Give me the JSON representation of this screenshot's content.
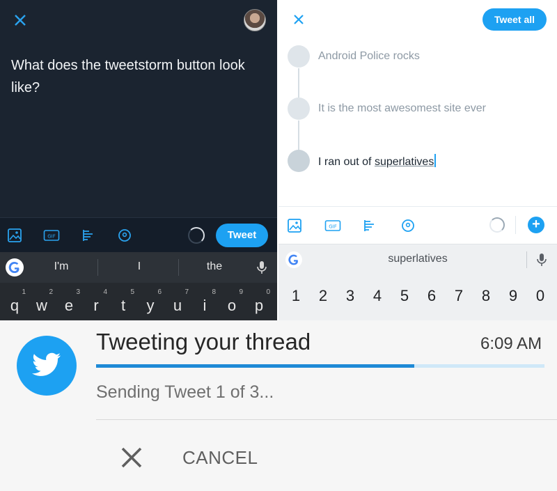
{
  "dark_composer": {
    "text": "What does the tweetstorm button look like?",
    "tweet_button": "Tweet",
    "toolbar_icons": [
      "image-icon",
      "gif-icon",
      "thread-icon",
      "location-icon"
    ],
    "suggestions": [
      "I'm",
      "I",
      "the"
    ],
    "keyboard": [
      {
        "num": "1",
        "ch": "q"
      },
      {
        "num": "2",
        "ch": "w"
      },
      {
        "num": "3",
        "ch": "e"
      },
      {
        "num": "4",
        "ch": "r"
      },
      {
        "num": "5",
        "ch": "t"
      },
      {
        "num": "6",
        "ch": "y"
      },
      {
        "num": "7",
        "ch": "u"
      },
      {
        "num": "8",
        "ch": "i"
      },
      {
        "num": "9",
        "ch": "o"
      },
      {
        "num": "0",
        "ch": "p"
      }
    ],
    "accent": "#1da1f2",
    "background": "#1b2430"
  },
  "light_thread": {
    "tweet_all_button": "Tweet all",
    "tweets": [
      {
        "text": "Android Police rocks"
      },
      {
        "text": "It is the most awesomest site ever"
      },
      {
        "text_prefix": "I ran out of ",
        "text_underlined": "superlatives"
      }
    ],
    "suggestion": "superlatives",
    "number_row": [
      "1",
      "2",
      "3",
      "4",
      "5",
      "6",
      "7",
      "8",
      "9",
      "0"
    ],
    "add_icon": "+"
  },
  "notification": {
    "title": "Tweeting your thread",
    "time": "6:09 AM",
    "status": "Sending Tweet 1 of 3...",
    "progress_fraction": 0.71,
    "cancel_label": "CANCEL",
    "brand_color": "#1da1f2"
  }
}
